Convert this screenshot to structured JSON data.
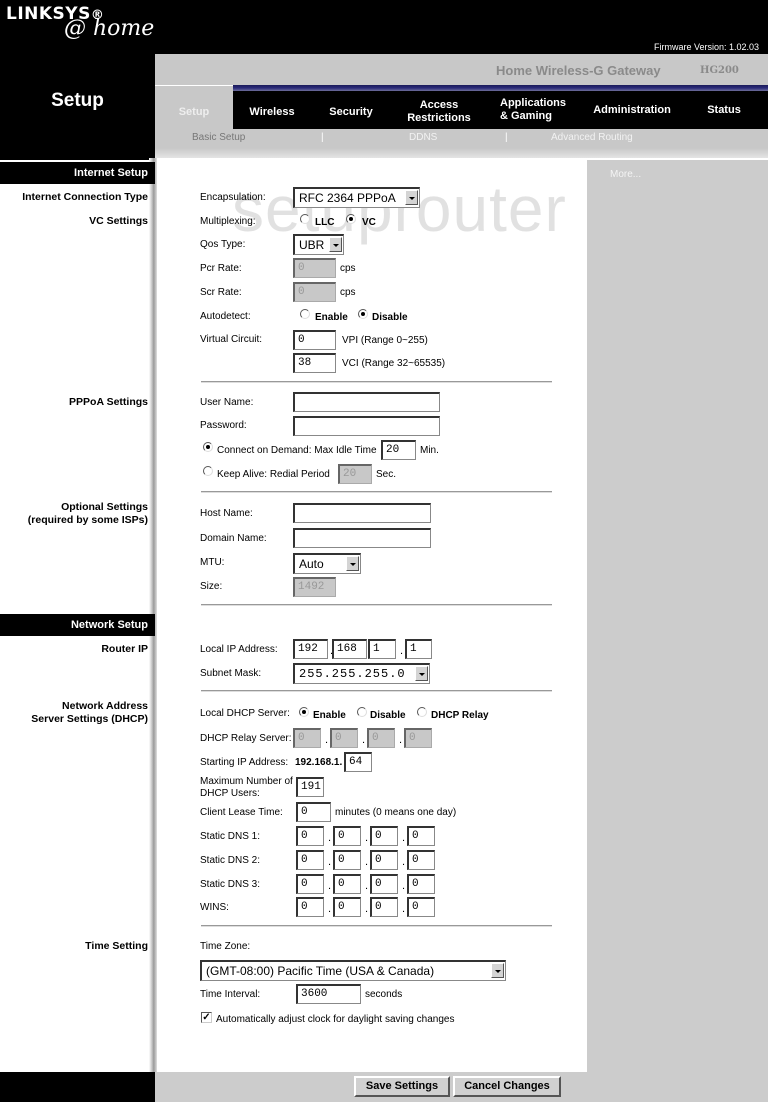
{
  "brand": {
    "logo_main": "LINKSYS",
    "logo_reg": "®",
    "logo_sub": "@ home"
  },
  "header": {
    "firmware": "Firmware Version: 1.02.03",
    "product_name": "Home Wireless-G Gateway",
    "model": "HG200",
    "page_title": "Setup"
  },
  "nav": {
    "tabs": [
      {
        "label": "Setup",
        "active": true
      },
      {
        "label": "Wireless"
      },
      {
        "label": "Security"
      },
      {
        "label": "Access",
        "label2": "Restrictions"
      },
      {
        "label": "Applications",
        "label2": "& Gaming"
      },
      {
        "label": "Administration"
      },
      {
        "label": "Status"
      }
    ],
    "subtabs": [
      {
        "label": "Basic Setup",
        "active": true
      },
      {
        "label": "DDNS"
      },
      {
        "label": "Advanced Routing"
      }
    ],
    "separator": "|"
  },
  "side": {
    "more": "More..."
  },
  "watermark": "setuprouter",
  "internet_setup": {
    "heading": "Internet Setup",
    "connection_type_label": "Internet Connection Type",
    "vc_settings_label": "VC Settings",
    "encapsulation_label": "Encapsulation:",
    "encapsulation_value": "RFC 2364 PPPoA",
    "multiplexing_label": "Multiplexing:",
    "multiplexing_options": [
      "LLC",
      "VC"
    ],
    "multiplexing_selected": "VC",
    "qos_label": "Qos Type:",
    "qos_value": "UBR",
    "pcr_label": "Pcr Rate:",
    "pcr_value": "0",
    "scr_label": "Scr Rate:",
    "scr_value": "0",
    "cps": "cps",
    "autodetect_label": "Autodetect:",
    "autodetect_options": [
      "Enable",
      "Disable"
    ],
    "autodetect_selected": "Disable",
    "virtual_circuit_label": "Virtual Circuit:",
    "vpi_value": "0",
    "vpi_hint": "VPI (Range 0~255)",
    "vci_value": "38",
    "vci_hint": "VCI (Range 32~65535)"
  },
  "pppoa": {
    "label": "PPPoA Settings",
    "username_label": "User Name:",
    "username_value": "",
    "password_label": "Password:",
    "password_value": "",
    "connect_on_demand_label": "Connect on Demand: Max Idle Time",
    "max_idle_value": "20",
    "min": "Min.",
    "keep_alive_label": "Keep Alive: Redial Period",
    "redial_value": "20",
    "sec": "Sec.",
    "selected": "connect_on_demand"
  },
  "optional": {
    "label1": "Optional Settings",
    "label2": "(required by some ISPs)",
    "host_label": "Host Name:",
    "host_value": "",
    "domain_label": "Domain Name:",
    "domain_value": "",
    "mtu_label": "MTU:",
    "mtu_value": "Auto",
    "size_label": "Size:",
    "size_value": "1492"
  },
  "network_setup": {
    "heading": "Network Setup",
    "router_ip_label": "Router IP",
    "local_ip_label": "Local IP Address:",
    "local_ip": [
      "192",
      "168",
      "1",
      "1"
    ],
    "subnet_label": "Subnet Mask:",
    "subnet_value": "255.255.255.0"
  },
  "dhcp": {
    "label1": "Network Address",
    "label2": "Server Settings (DHCP)",
    "server_label": "Local DHCP Server:",
    "server_options": [
      "Enable",
      "Disable",
      "DHCP Relay"
    ],
    "server_selected": "Enable",
    "relay_label": "DHCP Relay Server:",
    "relay_ip": [
      "0",
      "0",
      "0",
      "0"
    ],
    "start_label": "Starting IP Address:",
    "start_prefix": "192.168.1.",
    "start_value": "64",
    "max_label1": "Maximum Number of",
    "max_label2": "DHCP Users:",
    "max_value": "191",
    "lease_label": "Client Lease Time:",
    "lease_value": "0",
    "lease_hint": "minutes (0 means one day)",
    "dns1_label": "Static DNS 1:",
    "dns1": [
      "0",
      "0",
      "0",
      "0"
    ],
    "dns2_label": "Static DNS 2:",
    "dns2": [
      "0",
      "0",
      "0",
      "0"
    ],
    "dns3_label": "Static DNS 3:",
    "dns3": [
      "0",
      "0",
      "0",
      "0"
    ],
    "wins_label": "WINS:",
    "wins": [
      "0",
      "0",
      "0",
      "0"
    ]
  },
  "time": {
    "label": "Time Setting",
    "zone_label": "Time Zone:",
    "zone_value": "(GMT-08:00) Pacific Time (USA & Canada)",
    "interval_label": "Time Interval:",
    "interval_value": "3600",
    "seconds": "seconds",
    "dst_label": "Automatically adjust clock for daylight saving changes",
    "dst_checked": true,
    "check_mark": "✓"
  },
  "buttons": {
    "save": "Save Settings",
    "cancel": "Cancel Changes"
  },
  "dot": "."
}
